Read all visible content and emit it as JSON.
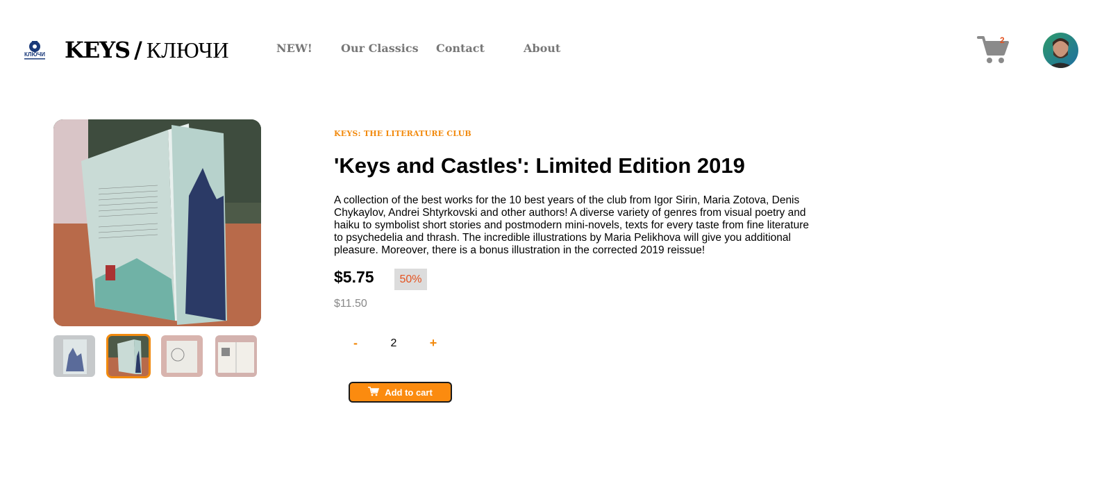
{
  "header": {
    "logo_text": "КЛЮЧИ",
    "brand_keys": "KEYS",
    "brand_slash": "/",
    "brand_kl": "КЛЮЧИ",
    "nav": [
      {
        "label": "NEW!"
      },
      {
        "label": "Our Classics"
      },
      {
        "label": "Contact"
      },
      {
        "label": "About"
      }
    ],
    "cart_count": "2",
    "cart_icon": "shopping-cart-icon"
  },
  "product": {
    "club": "KEYS: THE LITERATURE CLUB",
    "title": "'Keys and Castles': Limited Edition 2019",
    "description": "A collection of the best works for the 10 best years of the club from Igor Sirin, Maria Zotova, Denis Chykaylov, Andrei Shtyrkovski and other authors! A diverse variety of genres from visual poetry and haiku to symbolist short stories and postmodern mini-novels, texts for every taste from fine literature to psychedelia and thrash. The incredible illustrations by Maria Pelikhova will give you additional pleasure. Moreover, there is a bonus illustration in the corrected 2019 reissue!",
    "price": "$5.75",
    "discount": "50%",
    "old_price": "$11.50",
    "quantity": "2",
    "minus_label": "-",
    "plus_label": "+",
    "add_to_cart": "Add to cart"
  },
  "colors": {
    "accent": "#f28a0e",
    "button": "#fb8b0f",
    "discount_text": "#e5521f",
    "nav_text": "#777777"
  }
}
